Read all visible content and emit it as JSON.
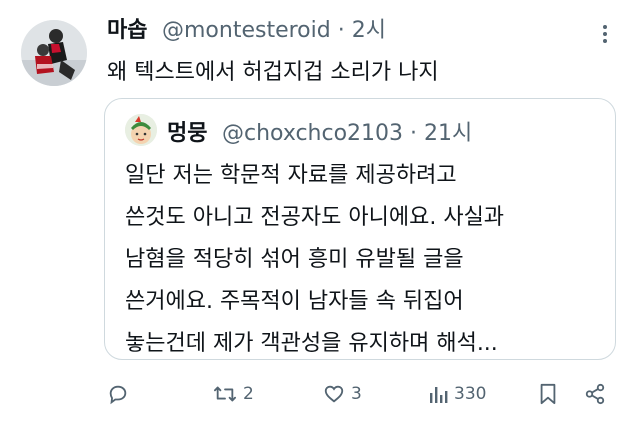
{
  "tweet": {
    "display_name": "마솝",
    "handle": "@montesteroid · 2시",
    "text": "왜 텍스트에서 허겁지겁 소리가 나지"
  },
  "quoted": {
    "display_name": "멍뭉",
    "handle": "@choxchco2103 · 21시",
    "lines": [
      "일단 저는 학문적 자료를 제공하려고",
      "쓴것도 아니고 전공자도 아니에요. 사실과",
      "남혐을 적당히 섞어 흥미 유발될 글을",
      "쓴거에요. 주목적이 남자들 속 뒤집어",
      "놓는건데 제가 객관성을 유지하며 해석..."
    ]
  },
  "actions": {
    "reply_count": "",
    "retweet_count": "2",
    "like_count": "3",
    "view_count": "330"
  },
  "icons": {
    "more": "more-vertical-icon",
    "reply": "reply-icon",
    "retweet": "retweet-icon",
    "like": "heart-icon",
    "views": "views-bar-chart-icon",
    "bookmark": "bookmark-icon",
    "share": "share-icon"
  },
  "colors": {
    "text": "#0f1419",
    "secondary": "#536471",
    "border": "#cfd9de"
  }
}
